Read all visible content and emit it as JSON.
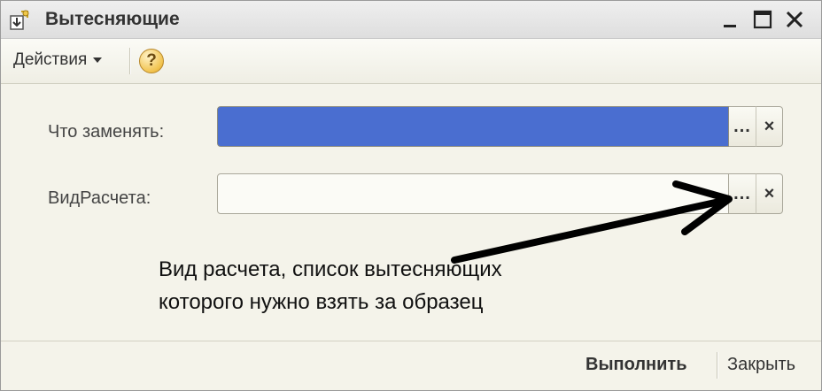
{
  "window": {
    "title": "Вытесняющие"
  },
  "toolbar": {
    "actions_label": "Действия",
    "help_label": "?"
  },
  "form": {
    "replace_label": "Что заменять:",
    "replace_value": "",
    "calc_type_label": "ВидРасчета:",
    "calc_type_value": "",
    "select_button_label": "...",
    "clear_button_label": "×"
  },
  "annotation": {
    "text": "Вид расчета, список вытесняющих которого нужно взять за образец"
  },
  "footer": {
    "run_label": "Выполнить",
    "close_label": "Закрыть"
  },
  "colors": {
    "selected_field": "#4a6ed0",
    "background": "#f4f3ea"
  }
}
